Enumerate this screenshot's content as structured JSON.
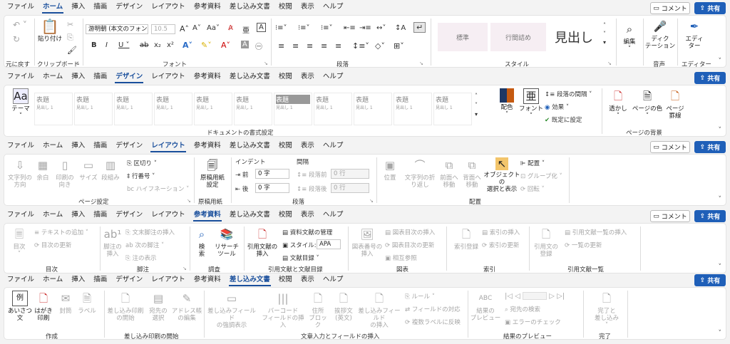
{
  "common": {
    "comment": "コメント",
    "share": "共有"
  },
  "tabs": [
    "ファイル",
    "ホーム",
    "挿入",
    "描画",
    "デザイン",
    "レイアウト",
    "参考資料",
    "差し込み文書",
    "校閲",
    "表示",
    "ヘルプ"
  ],
  "home": {
    "undo_group": "元に戻す",
    "paste": "貼り付け",
    "clipboard": "クリップボード",
    "font_name": "游明朝 (本文のフォン",
    "font_size": "10.5",
    "font_group": "フォント",
    "paragraph_group": "段落",
    "styles": [
      "標準",
      "行間詰め",
      "見出し"
    ],
    "styles_group": "スタイル",
    "edit": "編集",
    "dictation": "ディク\nテーション",
    "voice_group": "音声",
    "editor": "エディ\nター",
    "editor_group": "エディター"
  },
  "design": {
    "theme": "テーマ",
    "thumb_title": "表題",
    "thumb_head": "見出し 1",
    "doc_format": "ドキュメントの書式設定",
    "colors": "配色",
    "fonts": "フォント",
    "para_spacing": "段落の間隔",
    "effects": "効果",
    "set_default": "既定に設定",
    "watermark": "透かし",
    "page_color": "ページの色",
    "page_border": "ページ\n罫線",
    "page_bg": "ページの背景"
  },
  "layout": {
    "text_dir": "文字列の\n方向",
    "margins": "余白",
    "orientation": "印刷の\n向き",
    "size": "サイズ",
    "columns": "段組み",
    "breaks": "区切り",
    "line_numbers": "行番号",
    "hyphenation": "ハイフネーション",
    "page_setup": "ページ設定",
    "genko": "原稿用紙\n設定",
    "genko_group": "原稿用紙",
    "indent": "インデント",
    "spacing": "間隔",
    "before_lbl": "前",
    "after_lbl": "後",
    "indent_before": "0 字",
    "indent_after": "0 字",
    "spacing_before_lbl": "段落前",
    "spacing_after_lbl": "段落後",
    "spacing_before": "0 行",
    "spacing_after": "0 行",
    "paragraph_group": "段落",
    "position": "位置",
    "wrap": "文字列の折\nり返し",
    "forward": "前面へ\n移動",
    "backward": "背面へ\n移動",
    "selection_pane": "オブジェクトの\n選択と表示",
    "align": "配置",
    "group": "グループ化",
    "rotate": "回転",
    "arrange_group": "配置"
  },
  "references": {
    "toc": "目次",
    "add_text": "テキストの追加",
    "update_toc": "目次の更新",
    "toc_group": "目次",
    "footnote": "脚注の\n挿入",
    "endnote": "文末脚注の挿入",
    "next_fn": "次の脚注",
    "show_notes": "注の表示",
    "fn_group": "脚注",
    "search": "検\n索",
    "researcher": "リサーチ\nツール",
    "research_group": "調査",
    "citation": "引用文献の\n挿入",
    "manage_sources": "資料文献の管理",
    "style_lbl": "スタイル:",
    "style_val": "APA",
    "bibliography": "文献目録",
    "cite_group": "引用文献と文献目録",
    "caption": "図表番号の\n挿入",
    "insert_tof": "図表目次の挿入",
    "update_tof": "図表目次の更新",
    "cross_ref": "相互参照",
    "caption_group": "図表",
    "mark_entry": "索引登録",
    "insert_index": "索引の挿入",
    "update_index": "索引の更新",
    "index_group": "索引",
    "mark_citation": "引用文の\n登録",
    "insert_toa": "引用文献一覧の挿入",
    "update_toa": "一覧の更新",
    "toa_group": "引用文献一覧"
  },
  "mailings": {
    "greeting": "あいさつ\n文",
    "postcard": "はがき\n印刷",
    "envelope": "封筒",
    "label": "ラベル",
    "create_group": "作成",
    "start_merge": "差し込み印刷\nの開始",
    "recipients": "宛先の\n選択",
    "edit_list": "アドレス帳\nの編集",
    "start_group": "差し込み印刷の開始",
    "highlight": "差し込みフィールド\nの強調表示",
    "barcode": "バーコード\nフィールドの挿入",
    "address_block": "住所\nブロック",
    "greeting_line": "挨拶文\n(英文)",
    "insert_field": "差し込みフィールド\nの挿入",
    "rules": "ルール",
    "match_fields": "フィールドの対応",
    "update_labels": "複数ラベルに反映",
    "write_group": "文章入力とフィールドの挿入",
    "preview": "結果の\nプレビュー",
    "find_recipient": "宛先の検索",
    "check_errors": "エラーのチェック",
    "preview_group": "結果のプレビュー",
    "finish": "完了と\n差し込み",
    "finish_group": "完了"
  },
  "colors": {
    "accent": "#1a4f9c",
    "share_bg": "#1f5fb8"
  }
}
